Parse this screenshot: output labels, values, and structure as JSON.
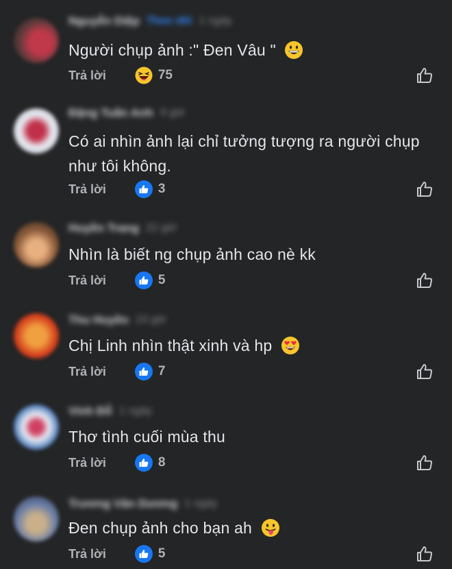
{
  "comments": [
    {
      "author": "Nguyễn Diệp",
      "follow": "Theo dõi",
      "time": "1 ngày",
      "text": "Người chụp ảnh :\"  Đen Vâu \"",
      "emoji": "grinning-face-icon",
      "reply_label": "Trả lời",
      "reaction": "haha",
      "reaction_count": "75",
      "avatar_colors": [
        "#3b2a2a",
        "#c0394a"
      ]
    },
    {
      "author": "Đặng Tuấn Anh",
      "follow": "",
      "time": "9 giờ",
      "text": "Có ai nhìn ảnh lại  chỉ tưởng tượng ra người chụp như tôi không.",
      "emoji": "",
      "reply_label": "Trả lời",
      "reaction": "like",
      "reaction_count": "3",
      "avatar_colors": [
        "#d8dde6",
        "#c0304a"
      ]
    },
    {
      "author": "Huyền Trang",
      "follow": "",
      "time": "22 giờ",
      "text": "Nhìn là biết ng chụp ảnh cao nè kk",
      "emoji": "",
      "reply_label": "Trả lời",
      "reaction": "like",
      "reaction_count": "5",
      "avatar_colors": [
        "#8a5a3a",
        "#e8b080"
      ]
    },
    {
      "author": "Thu Huyền",
      "follow": "",
      "time": "23 giờ",
      "text": "Chị Linh nhìn thật xinh và hp",
      "emoji": "heart-eyes-icon",
      "reply_label": "Trả lời",
      "reaction": "like",
      "reaction_count": "7",
      "avatar_colors": [
        "#d8431f",
        "#f0a040"
      ]
    },
    {
      "author": "Vinh Đỗ",
      "follow": "",
      "time": "1 ngày",
      "text": "Thơ tình cuối mùa thu",
      "emoji": "",
      "reply_label": "Trả lời",
      "reaction": "like",
      "reaction_count": "8",
      "avatar_colors": [
        "#e8ecf4",
        "#d04060"
      ]
    },
    {
      "author": "Trương Văn Dương",
      "follow": "",
      "time": "1 ngày",
      "text": "Đen chụp ảnh cho bạn ah",
      "emoji": "tongue-out-icon",
      "reply_label": "Trả lời",
      "reaction": "like",
      "reaction_count": "5",
      "avatar_colors": [
        "#6b7fa8",
        "#c9b08a"
      ]
    }
  ]
}
